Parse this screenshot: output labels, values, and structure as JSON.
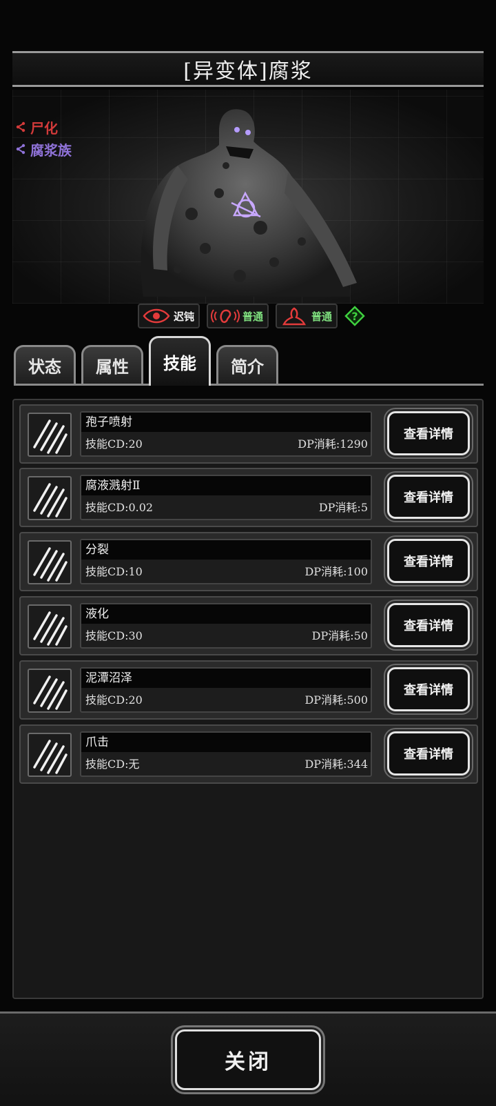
{
  "title": "[异变体]腐浆",
  "tags": [
    {
      "label": "尸化",
      "color": "#d23a3a",
      "icon": "share-icon"
    },
    {
      "label": "腐浆族",
      "color": "#8f72d8",
      "icon": "share-icon"
    }
  ],
  "senses": [
    {
      "icon": "eye-icon",
      "label": "迟钝",
      "color": "#e33b3b",
      "label_color": "#f2f2f2"
    },
    {
      "icon": "ear-icon",
      "label": "普通",
      "color": "#e33b3b",
      "label_color": "#7fe07f"
    },
    {
      "icon": "smell-icon",
      "label": "普通",
      "color": "#e33b3b",
      "label_color": "#7fe07f"
    }
  ],
  "help_icon": "question-diamond-icon",
  "tabs": [
    {
      "label": "状态",
      "active": false
    },
    {
      "label": "属性",
      "active": false
    },
    {
      "label": "技能",
      "active": true
    },
    {
      "label": "简介",
      "active": false
    }
  ],
  "skills": [
    {
      "name": "孢子喷射",
      "cd": "技能CD:20",
      "dp": "DP消耗:1290",
      "button": "查看详情",
      "icon": "claw-icon"
    },
    {
      "name": "腐液溅射Ⅱ",
      "cd": "技能CD:0.02",
      "dp": "DP消耗:5",
      "button": "查看详情",
      "icon": "claw-icon"
    },
    {
      "name": "分裂",
      "cd": "技能CD:10",
      "dp": "DP消耗:100",
      "button": "查看详情",
      "icon": "claw-icon"
    },
    {
      "name": "液化",
      "cd": "技能CD:30",
      "dp": "DP消耗:50",
      "button": "查看详情",
      "icon": "claw-icon"
    },
    {
      "name": "泥潭沼泽",
      "cd": "技能CD:20",
      "dp": "DP消耗:500",
      "button": "查看详情",
      "icon": "claw-icon"
    },
    {
      "name": "爪击",
      "cd": "技能CD:无",
      "dp": "DP消耗:344",
      "button": "查看详情",
      "icon": "claw-icon"
    }
  ],
  "close_label": "关闭"
}
